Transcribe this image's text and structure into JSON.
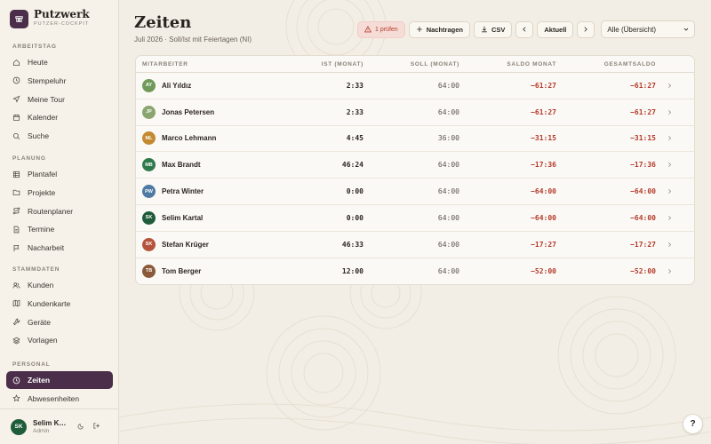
{
  "brand": {
    "name": "Putzwerk",
    "subtitle": "PUTZER-COCKPIT"
  },
  "sidebar": {
    "sections": [
      {
        "label": "ARBEITSTAG",
        "items": [
          {
            "label": "Heute",
            "icon": "home-icon"
          },
          {
            "label": "Stempeluhr",
            "icon": "clock-icon"
          },
          {
            "label": "Meine Tour",
            "icon": "navigation-icon"
          },
          {
            "label": "Kalender",
            "icon": "calendar-icon"
          },
          {
            "label": "Suche",
            "icon": "search-icon"
          }
        ]
      },
      {
        "label": "PLANUNG",
        "items": [
          {
            "label": "Plantafel",
            "icon": "grid-icon"
          },
          {
            "label": "Projekte",
            "icon": "folder-icon"
          },
          {
            "label": "Routenplaner",
            "icon": "route-icon"
          },
          {
            "label": "Termine",
            "icon": "document-icon"
          },
          {
            "label": "Nacharbeit",
            "icon": "flag-icon"
          }
        ]
      },
      {
        "label": "STAMMDATEN",
        "items": [
          {
            "label": "Kunden",
            "icon": "users-icon"
          },
          {
            "label": "Kundenkarte",
            "icon": "map-icon"
          },
          {
            "label": "Geräte",
            "icon": "wrench-icon"
          },
          {
            "label": "Vorlagen",
            "icon": "layers-icon"
          }
        ]
      },
      {
        "label": "PERSONAL",
        "items": [
          {
            "label": "Zeiten",
            "icon": "clock-icon",
            "active": true
          },
          {
            "label": "Abwesenheiten",
            "icon": "star-icon"
          }
        ]
      }
    ]
  },
  "user": {
    "initials": "SK",
    "name": "Selim Ka...",
    "role": "Admin"
  },
  "page": {
    "title": "Zeiten",
    "subtitle": "Juli 2026 · Soll/Ist mit Feiertagen (NI)"
  },
  "toolbar": {
    "warn_label": "1 prüfen",
    "add_label": "Nachtragen",
    "csv_label": "CSV",
    "current_label": "Aktuell",
    "filter_value": "Alle (Übersicht)"
  },
  "table": {
    "headers": {
      "name": "MITARBEITER",
      "ist": "IST (MONAT)",
      "soll": "SOLL (MONAT)",
      "saldo": "SALDO MONAT",
      "total": "GESAMTSALDO"
    },
    "rows": [
      {
        "initials": "AY",
        "name": "Ali Yıldız",
        "ist": "2:33",
        "soll": "64:00",
        "saldo": "−61:27",
        "total": "−61:27",
        "color": "#6f9a5a"
      },
      {
        "initials": "JP",
        "name": "Jonas Petersen",
        "ist": "2:33",
        "soll": "64:00",
        "saldo": "−61:27",
        "total": "−61:27",
        "color": "#8aa56f"
      },
      {
        "initials": "ML",
        "name": "Marco Lehmann",
        "ist": "4:45",
        "soll": "36:00",
        "saldo": "−31:15",
        "total": "−31:15",
        "color": "#c48a32"
      },
      {
        "initials": "MB",
        "name": "Max Brandt",
        "ist": "46:24",
        "soll": "64:00",
        "saldo": "−17:36",
        "total": "−17:36",
        "color": "#2f7a4a"
      },
      {
        "initials": "PW",
        "name": "Petra Winter",
        "ist": "0:00",
        "soll": "64:00",
        "saldo": "−64:00",
        "total": "−64:00",
        "color": "#4f7aa3"
      },
      {
        "initials": "SK",
        "name": "Selim Kartal",
        "ist": "0:00",
        "soll": "64:00",
        "saldo": "−64:00",
        "total": "−64:00",
        "color": "#1f5c3a"
      },
      {
        "initials": "SK",
        "name": "Stefan Krüger",
        "ist": "46:33",
        "soll": "64:00",
        "saldo": "−17:27",
        "total": "−17:27",
        "color": "#b5543c"
      },
      {
        "initials": "TB",
        "name": "Tom Berger",
        "ist": "12:00",
        "soll": "64:00",
        "saldo": "−52:00",
        "total": "−52:00",
        "color": "#8a5a3a"
      }
    ]
  },
  "help_label": "?",
  "colors": {
    "accent": "#4b2f4a",
    "negative": "#b33a2a",
    "warning_bg": "#f6dcd6"
  }
}
